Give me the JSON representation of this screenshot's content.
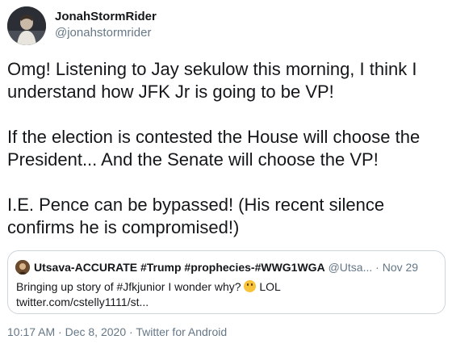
{
  "author": {
    "display_name": "JonahStormRider",
    "handle": "@jonahstormrider"
  },
  "tweet": {
    "paragraphs": [
      "Omg! Listening to Jay sekulow this morning, I think I understand how JFK Jr is going to be VP!",
      "If the election is contested the House will choose the President... And the Senate will choose the VP!",
      "I.E. Pence can be bypassed! (His recent silence confirms he is compromised!)"
    ]
  },
  "quoted_tweet": {
    "display_name": "Utsava-ACCURATE #Trump #prophecies-#WWG1WGA",
    "handle": "@Utsa...",
    "separator": "·",
    "date": "Nov 29",
    "text_before_emoji": "Bringing up story of #Jfkjunior I wonder why?",
    "emoji": "thinking-face-emoji",
    "text_after_emoji": "LOL",
    "link": "twitter.com/cstelly1111/st..."
  },
  "meta": {
    "time": "10:17 AM",
    "sep1": "·",
    "date": "Dec 8, 2020",
    "sep2": "·",
    "source": "Twitter for Android"
  }
}
